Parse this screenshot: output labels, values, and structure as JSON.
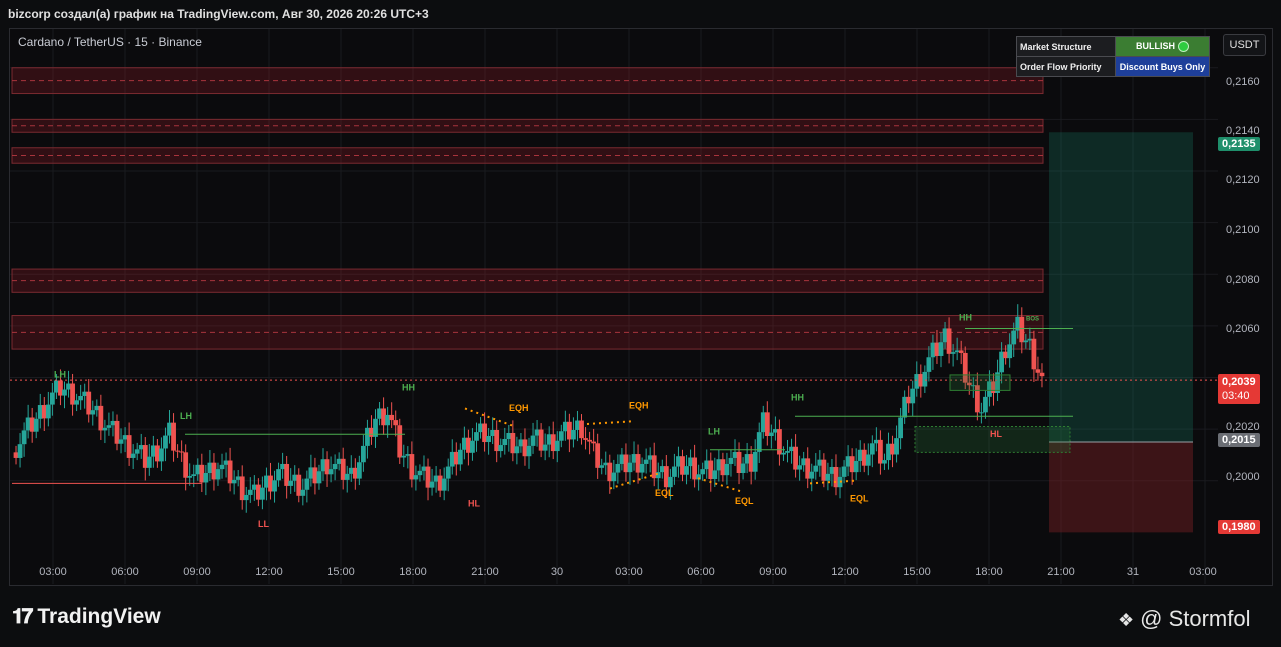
{
  "header": "bizcorp создал(а) график на TradingView.com, Авг 30, 2026 20:26 UTC+3",
  "symbol": "Cardano / TetherUS · 15 · Binance",
  "currency_button": "USDT",
  "market_table": {
    "row1_label": "Market Structure",
    "row1_value": "BULLISH",
    "row2_label": "Order Flow Priority",
    "row2_value": "Discount Buys Only"
  },
  "tags": {
    "target": "0,2135",
    "current": "0,2039",
    "countdown": "03:40",
    "entry": "0,2015",
    "stop": "0,1980"
  },
  "footer": {
    "brand": "TradingView",
    "author": "@ Stormfol"
  },
  "colors": {
    "up": "#26a69a",
    "down": "#ef5350",
    "bullish": "#3b7d32",
    "priority": "#1e3f9a",
    "label_orange": "#ff9800",
    "label_green": "#4caf50",
    "label_red": "#ef5350"
  },
  "chart_data": {
    "type": "candlestick",
    "x_tick_labels": [
      "03:00",
      "06:00",
      "09:00",
      "12:00",
      "15:00",
      "18:00",
      "21:00",
      "30",
      "03:00",
      "06:00",
      "09:00",
      "12:00",
      "15:00",
      "18:00",
      "21:00",
      "31",
      "03:00"
    ],
    "y_tick_labels": [
      "0,2160",
      "0,2140",
      "0,2120",
      "0,2100",
      "0,2080",
      "0,2060",
      "0,2040",
      "0,2020",
      "0,2000"
    ],
    "ylim": [
      0.196,
      0.2175
    ],
    "close_path": [
      0.2011,
      0.2018,
      0.2024,
      0.2031,
      0.2036,
      0.2034,
      0.203,
      0.2026,
      0.202,
      0.2016,
      0.2012,
      0.2008,
      0.2012,
      0.2018,
      0.2008,
      0.2001,
      0.2003,
      0.2006,
      0.2002,
      0.1997,
      0.1994,
      0.1999,
      0.2003,
      0.2,
      0.1998,
      0.2002,
      0.2007,
      0.2004,
      0.2002,
      0.2012,
      0.2024,
      0.2027,
      0.2012,
      0.2005,
      0.2001,
      0.1999,
      0.2004,
      0.2012,
      0.2017,
      0.2018,
      0.2016,
      0.2014,
      0.2013,
      0.2016,
      0.2014,
      0.2017,
      0.2019,
      0.2021,
      0.201,
      0.2004,
      0.2005,
      0.2007,
      0.2008,
      0.2004,
      0.2002,
      0.2005,
      0.2006,
      0.2003,
      0.2004,
      0.2008,
      0.2006,
      0.2008,
      0.2022,
      0.2017,
      0.201,
      0.2006,
      0.2005,
      0.2003,
      0.2002,
      0.2005,
      0.2009,
      0.2013,
      0.2008,
      0.2018,
      0.2033,
      0.2041,
      0.2049,
      0.2056,
      0.2049,
      0.2037,
      0.2028,
      0.2037,
      0.2052,
      0.2059,
      0.2052,
      0.2039
    ],
    "zones": [
      {
        "type": "supply",
        "top": 0.216,
        "bottom": 0.215
      },
      {
        "type": "supply",
        "top": 0.214,
        "bottom": 0.2135
      },
      {
        "type": "supply",
        "top": 0.2129,
        "bottom": 0.2123
      },
      {
        "type": "supply",
        "top": 0.2082,
        "bottom": 0.2073
      },
      {
        "type": "supply",
        "top": 0.2064,
        "bottom": 0.2051
      }
    ],
    "position": {
      "target": 0.2135,
      "entry": 0.2015,
      "stop": 0.198
    },
    "structure_labels": [
      "LH",
      "LH",
      "HH",
      "LL",
      "HL",
      "EQH",
      "EQH",
      "EQL",
      "EQL",
      "LH",
      "HH",
      "EQL",
      "HH",
      "HL",
      "BOS"
    ]
  }
}
